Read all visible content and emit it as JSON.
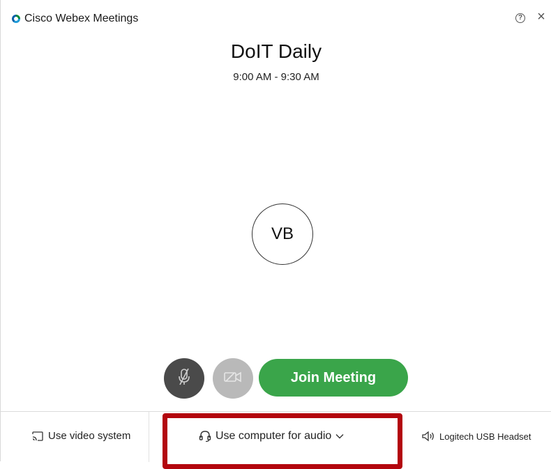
{
  "window": {
    "app_title": "Cisco Webex Meetings",
    "help_symbol": "?",
    "close_symbol": "×"
  },
  "meeting": {
    "title": "DoIT Daily",
    "time": "9:00 AM - 9:30 AM"
  },
  "avatar": {
    "initials": "VB"
  },
  "controls": {
    "join_label": "Join Meeting",
    "mute_icon": "microphone-muted-icon",
    "video_icon": "video-off-icon"
  },
  "bottom": {
    "video_system_label": "Use video system",
    "audio_label": "Use computer for audio",
    "speaker_label": "Logitech USB Headset"
  },
  "colors": {
    "join_green": "#3aa54a",
    "mute_dark": "#4a4a4a",
    "video_grey": "#b9b9b9",
    "highlight_red": "#b3060e"
  }
}
